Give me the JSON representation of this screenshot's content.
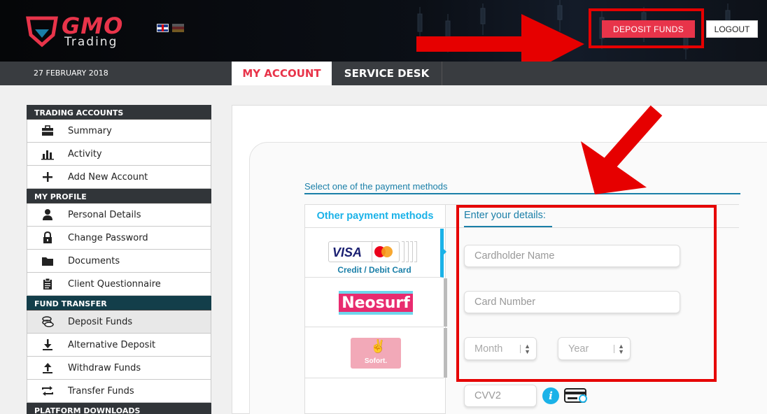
{
  "header": {
    "logo_text": "GMO",
    "logo_subtext": "Trading",
    "deposit_label": "DEPOSIT FUNDS",
    "logout_label": "LOGOUT",
    "accent_color": "#e8344a"
  },
  "navbar": {
    "date": "27 FEBRUARY 2018",
    "tabs": [
      {
        "label": "MY ACCOUNT",
        "active": true
      },
      {
        "label": "SERVICE DESK",
        "active": false
      }
    ]
  },
  "sidebar": {
    "sections": [
      {
        "title": "TRADING ACCOUNTS",
        "items": [
          {
            "label": "Summary",
            "icon": "briefcase-icon"
          },
          {
            "label": "Activity",
            "icon": "bar-chart-icon"
          },
          {
            "label": "Add New Account",
            "icon": "plus-icon"
          }
        ]
      },
      {
        "title": "MY PROFILE",
        "items": [
          {
            "label": "Personal Details",
            "icon": "user-icon"
          },
          {
            "label": "Change Password",
            "icon": "lock-icon"
          },
          {
            "label": "Documents",
            "icon": "folder-icon"
          },
          {
            "label": "Client Questionnaire",
            "icon": "clipboard-icon"
          }
        ]
      },
      {
        "title": "FUND TRANSFER",
        "items": [
          {
            "label": "Deposit Funds",
            "icon": "coins-icon",
            "active": true
          },
          {
            "label": "Alternative Deposit",
            "icon": "download-icon"
          },
          {
            "label": "Withdraw Funds",
            "icon": "upload-icon"
          },
          {
            "label": "Transfer Funds",
            "icon": "transfer-icon"
          }
        ]
      },
      {
        "title": "PLATFORM DOWNLOADS",
        "items": []
      }
    ]
  },
  "payment": {
    "select_title": "Select one of the payment methods",
    "other_methods_title": "Other payment methods",
    "methods": [
      {
        "name": "Credit / Debit Card",
        "logo_text": "VISA",
        "selected": true
      },
      {
        "name": "Neosurf",
        "logo_text": "Neosurf"
      },
      {
        "name": "Sofort",
        "logo_text": "Sofort."
      }
    ],
    "details_title": "Enter your details:",
    "fields": {
      "cardholder_placeholder": "Cardholder Name",
      "card_number_placeholder": "Card Number",
      "month_label": "Month",
      "year_label": "Year",
      "cvv_placeholder": "CVV2"
    },
    "info_glyph": "i"
  }
}
